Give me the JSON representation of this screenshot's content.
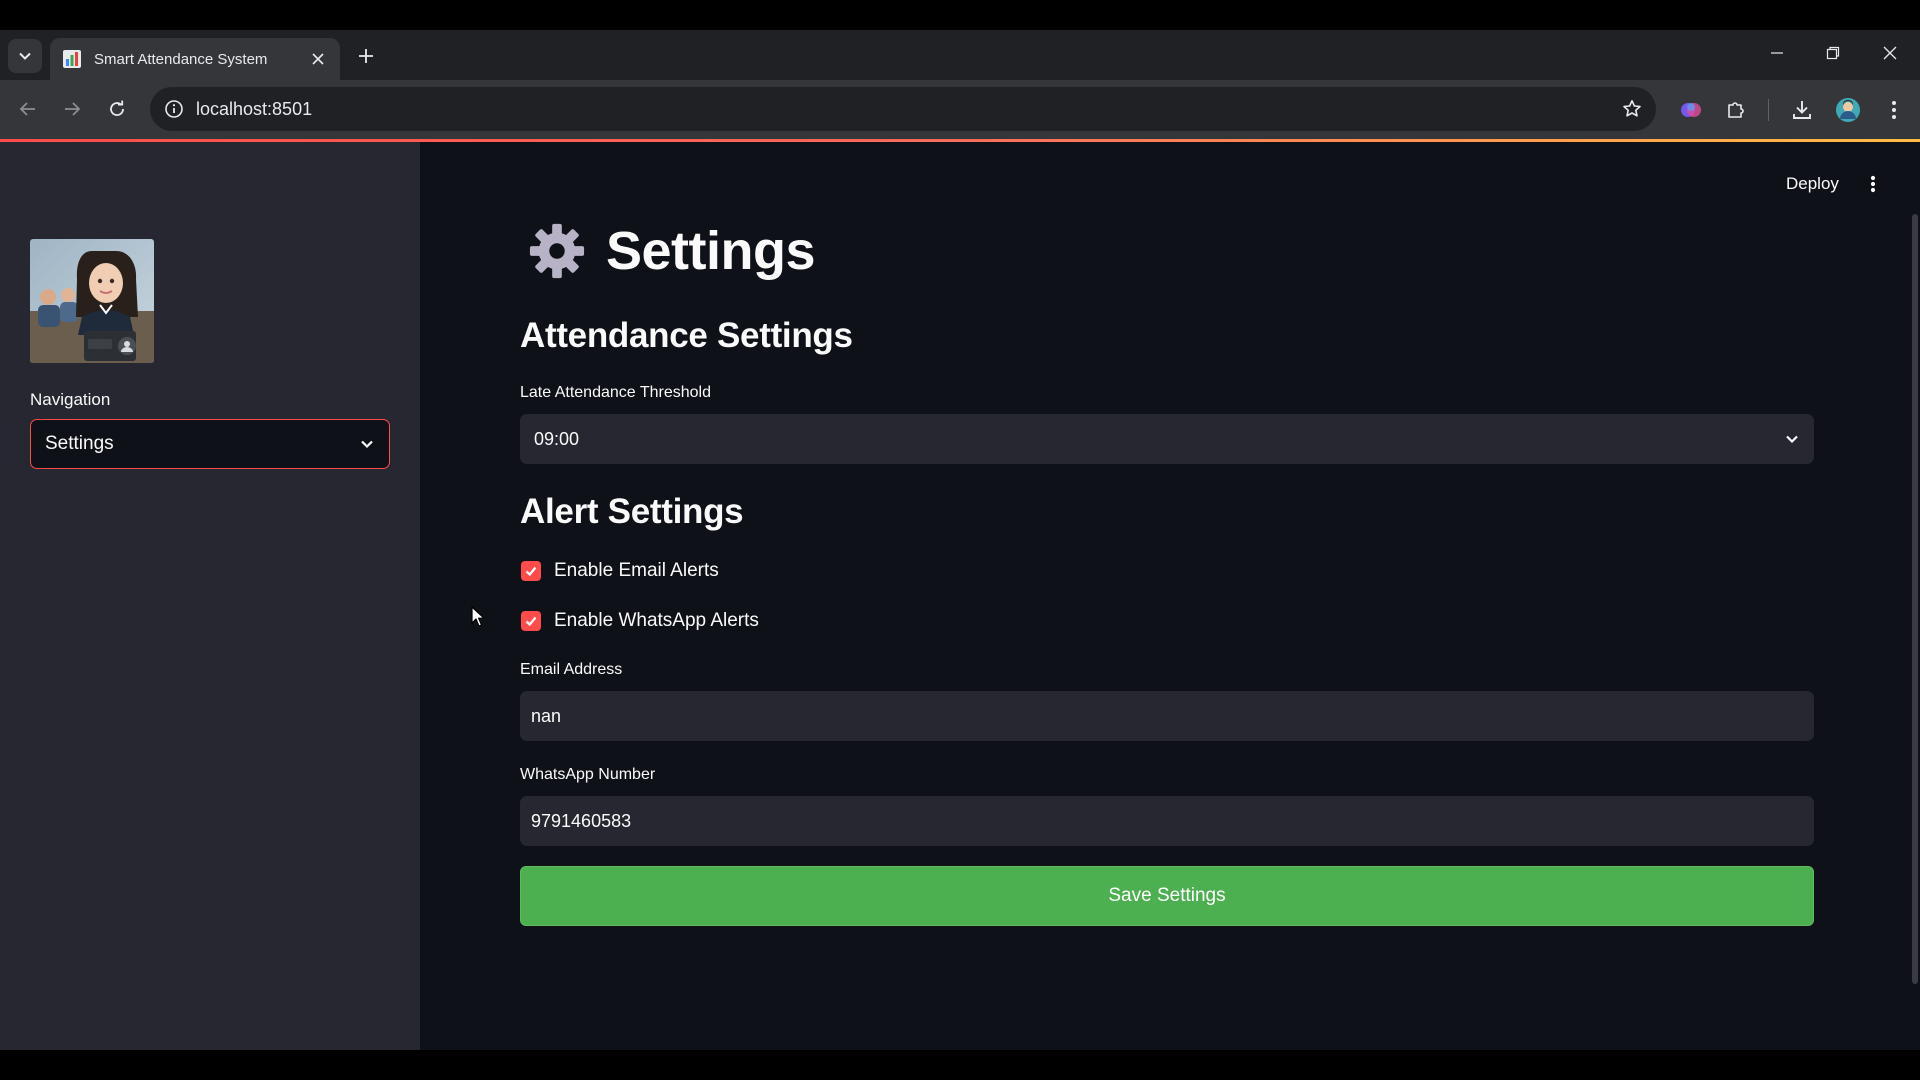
{
  "browser": {
    "tab_title": "Smart Attendance System",
    "url": "localhost:8501"
  },
  "sidebar": {
    "nav_label": "Navigation",
    "nav_selected": "Settings"
  },
  "main": {
    "deploy_label": "Deploy",
    "page_title": "Settings",
    "attendance_heading": "Attendance Settings",
    "late_threshold_label": "Late Attendance Threshold",
    "late_threshold_value": "09:00",
    "alert_heading": "Alert Settings",
    "email_alerts_label": "Enable Email Alerts",
    "email_alerts_checked": true,
    "whatsapp_alerts_label": "Enable WhatsApp Alerts",
    "whatsapp_alerts_checked": true,
    "email_label": "Email Address",
    "email_value": "nan",
    "whatsapp_label": "WhatsApp Number",
    "whatsapp_value": "9791460583",
    "save_button_label": "Save Settings"
  },
  "colors": {
    "accent": "#ff4b4b",
    "save_button": "#4caf50",
    "main_bg": "#0e1117",
    "sidebar_bg": "#262730"
  },
  "icons": {
    "page_title_icon": "gear-icon",
    "sidebar_image": "student-photo-logo"
  }
}
